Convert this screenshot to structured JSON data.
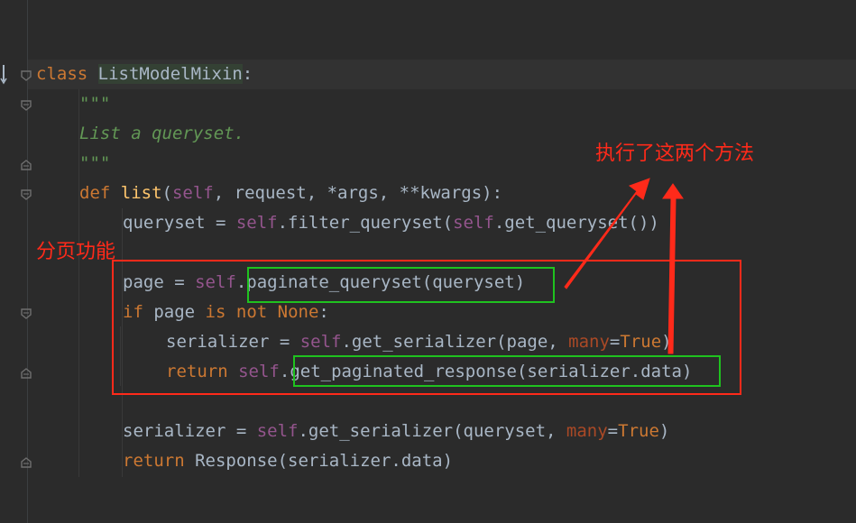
{
  "code": {
    "line1": {
      "kw_class": "class ",
      "class_name": "ListModelMixin",
      "colon": ":"
    },
    "line2": {
      "doc_open": "\"\"\""
    },
    "line3": {
      "doc_text": "List a queryset."
    },
    "line4": {
      "doc_close": "\"\"\""
    },
    "line5": {
      "kw_def": "def ",
      "fn_name": "list",
      "p_open": "(",
      "self": "self",
      "rest": ", request, *args, **kwargs):"
    },
    "line6": {
      "pre": "queryset = ",
      "self1": "self",
      "mid": ".filter_queryset(",
      "self2": "self",
      "post": ".get_queryset())"
    },
    "line7": {
      "pre": "page = ",
      "self": "self",
      "dot": ".",
      "post": "paginate_queryset(queryset)"
    },
    "line8": {
      "kw_if": "if",
      "mid1": " page ",
      "kw_is": "is",
      "sp": " ",
      "kw_not": "not",
      "sp2": " ",
      "kw_none": "None",
      "colon": ":"
    },
    "line9": {
      "pre": "serializer = ",
      "self": "self",
      "mid": ".get_serializer(page, ",
      "param": "many",
      "eq": "=",
      "kw_true": "True",
      "close": ")"
    },
    "line10": {
      "kw_return": "return",
      "sp": " ",
      "self": "self",
      "dot": ".",
      "post": "get_paginated_response(serializer.data)"
    },
    "line11": {
      "pre": "serializer = ",
      "self": "self",
      "mid": ".get_serializer(queryset, ",
      "param": "many",
      "eq": "=",
      "kw_true": "True",
      "close": ")"
    },
    "line12": {
      "kw_return": "return",
      "post": " Response(serializer.data)"
    }
  },
  "annotations": {
    "pagination_label": "分页功能",
    "methods_label": "执行了这两个方法",
    "red_color": "#ff2a1a",
    "green_color": "#1fc21f"
  }
}
